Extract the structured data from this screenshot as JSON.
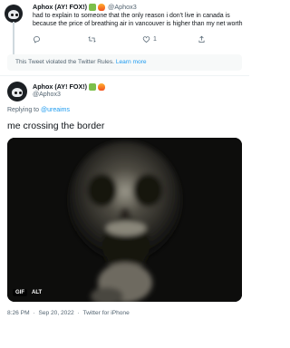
{
  "tweet1": {
    "display_name": "Aphox (AY! FOX!)",
    "handle": "@Aphox3",
    "text_lines": [
      "had to explain to someone that the only reason i don't live in canada is",
      "because the price of breathing air in vancouver is higher than my net worth"
    ],
    "reply_count": "",
    "retweet_count": "",
    "like_count": "1"
  },
  "violation": {
    "text": "This Tweet violated the Twitter Rules.",
    "link": "Learn more"
  },
  "tweet2": {
    "display_name": "Aphox (AY! FOX!)",
    "handle": "@Aphox3",
    "replying_prefix": "Replying to",
    "replying_to": "@ureaims",
    "text": "me crossing the border",
    "media": {
      "gif_label": "GIF",
      "alt_label": "ALT"
    },
    "time": "8:26 PM",
    "date": "Sep 20, 2022",
    "source": "Twitter for iPhone"
  }
}
